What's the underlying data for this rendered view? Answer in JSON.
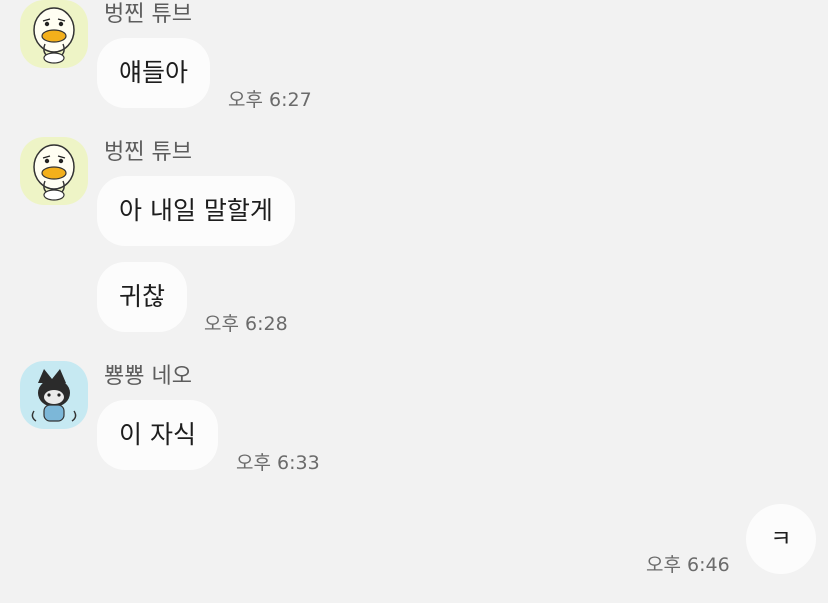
{
  "messages": [
    {
      "sender": "벙찐 튜브",
      "avatar": "tube-duck-avatar",
      "bubbles": [
        "얘들아"
      ],
      "time": "오후 6:27"
    },
    {
      "sender": "벙찐 튜브",
      "avatar": "tube-duck-avatar",
      "bubbles": [
        "아 내일 말할게",
        "귀찮"
      ],
      "time": "오후 6:28"
    },
    {
      "sender": "뿅뿅 네오",
      "avatar": "neo-cat-avatar",
      "bubbles": [
        "이 자식"
      ],
      "time": "오후 6:33"
    }
  ],
  "my_message": {
    "text": "ㅋ",
    "time": "오후 6:46"
  },
  "colors": {
    "background": "#f2f2f2",
    "bubble": "#fcfcfc",
    "tube_avatar_bg": "#eef4c6",
    "neo_avatar_bg": "#c6e9f2"
  }
}
